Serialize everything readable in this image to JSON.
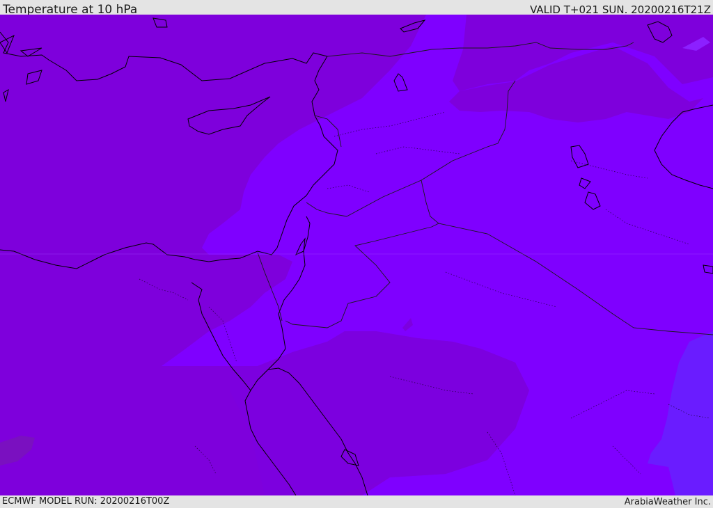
{
  "header": {
    "title": "Temperature at 10 hPa",
    "valid": "VALID T+021 SUN. 20200216T21Z"
  },
  "footer": {
    "model_run": "ECMWF MODEL RUN: 20200216T00Z",
    "credit": "ArabiaWeather Inc."
  },
  "map": {
    "field": "temperature",
    "level": "10 hPa",
    "colors": {
      "warm_fill": "#7e00dc",
      "mid_fill": "#7f00ff",
      "cool_fill": "#6a1cff",
      "warmest_fill": "#7a10c0",
      "coastline": "#000000",
      "border": "#1a1a1a"
    }
  }
}
